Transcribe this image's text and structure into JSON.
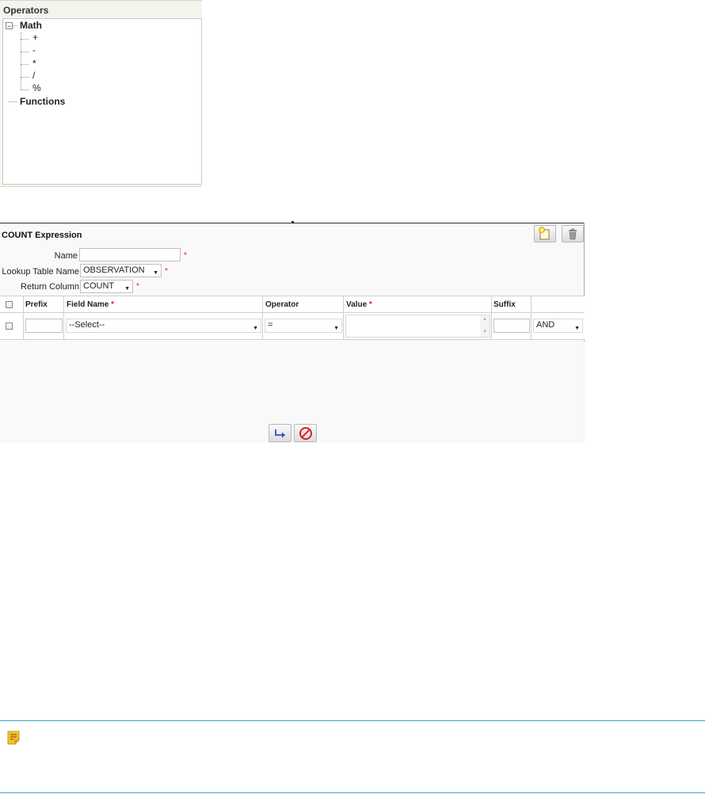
{
  "operators": {
    "title": "Operators",
    "math": {
      "label": "Math",
      "toggle": "−",
      "items": [
        "+",
        "-",
        "*",
        "/",
        "%"
      ]
    },
    "functions": {
      "label": "Functions"
    }
  },
  "expression": {
    "title": "COUNT Expression",
    "new_icon": "new-document-icon",
    "delete_icon": "trash-icon",
    "name_label": "Name",
    "name_value": "",
    "lookup_label": "Lookup Table Name",
    "lookup_value": "OBSERVATION",
    "return_label": "Return Column",
    "return_value": "COUNT",
    "required_mark": "*",
    "grid": {
      "headers": {
        "prefix": "Prefix",
        "field_name": "Field Name",
        "operator": "Operator",
        "value": "Value",
        "suffix": "Suffix"
      },
      "row": {
        "prefix": "",
        "field_name": "--Select--",
        "operator": "=",
        "value": "",
        "suffix": "",
        "conjunction": "AND"
      }
    },
    "buttons": {
      "apply_icon": "enter-arrow-icon",
      "cancel_icon": "cancel-icon"
    }
  },
  "note": {
    "icon": "note-icon"
  }
}
